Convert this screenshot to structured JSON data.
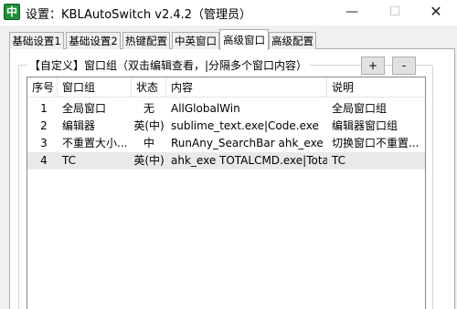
{
  "window": {
    "app_icon_glyph": "中",
    "title": "设置：KBLAutoSwitch v2.4.2（管理员）",
    "minimize_glyph": "—",
    "maximize_glyph": "☐",
    "close_glyph": "✕"
  },
  "tabs": [
    {
      "label": "基础设置1",
      "active": false
    },
    {
      "label": "基础设置2",
      "active": false
    },
    {
      "label": "热键配置",
      "active": false
    },
    {
      "label": "中英窗口",
      "active": false
    },
    {
      "label": "高级窗口",
      "active": true
    },
    {
      "label": "高级配置",
      "active": false
    }
  ],
  "group": {
    "title": "【自定义】窗口组（双击编辑查看，|分隔多个窗口内容）",
    "add_label": "+",
    "remove_label": "-"
  },
  "table": {
    "headers": [
      "序号",
      "窗口组",
      "状态",
      "内容",
      "说明"
    ],
    "rows": [
      {
        "no": "1",
        "group": "全局窗口",
        "state": "无",
        "content": "AllGlobalWin",
        "desc": "全局窗口组",
        "selected": false
      },
      {
        "no": "2",
        "group": "编辑器",
        "state": "英(中)",
        "content": "sublime_text.exe|Code.exe",
        "desc": "编辑器窗口组",
        "selected": false
      },
      {
        "no": "3",
        "group": "不重置大小...",
        "state": "中",
        "content": "RunAny_SearchBar ahk_exe R...",
        "desc": "切换窗口不重置...",
        "selected": false
      },
      {
        "no": "4",
        "group": "TC",
        "state": "英(中)",
        "content": "ahk_exe TOTALCMD.exe|Tota...",
        "desc": "TC",
        "selected": true
      }
    ]
  }
}
